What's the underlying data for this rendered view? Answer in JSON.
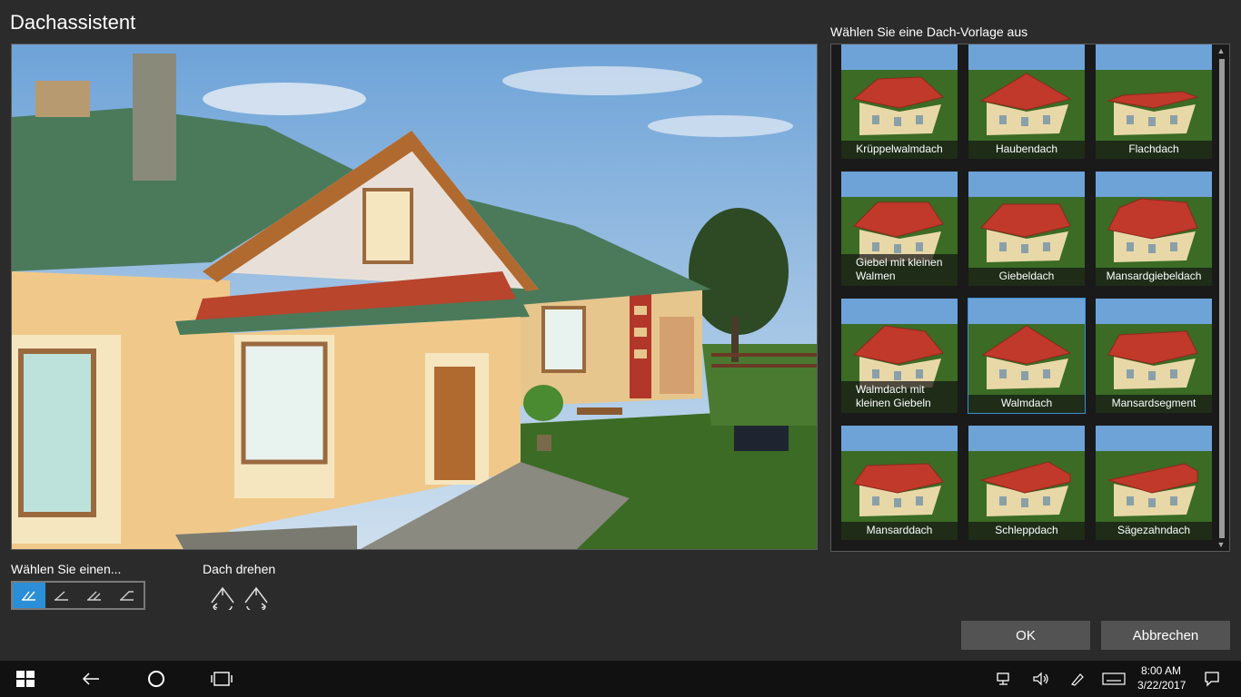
{
  "dialog": {
    "title": "Dachassistent"
  },
  "gallery": {
    "title": "Wählen Sie eine Dach-Vorlage aus",
    "templates": [
      {
        "label": "Krüppelwalmdach"
      },
      {
        "label": "Haubendach"
      },
      {
        "label": "Flachdach"
      },
      {
        "label": "Giebel mit kleinen Walmen"
      },
      {
        "label": "Giebeldach"
      },
      {
        "label": "Mansardgiebeldach"
      },
      {
        "label": "Walmdach mit kleinen Giebeln"
      },
      {
        "label": "Walmdach",
        "selected": true
      },
      {
        "label": "Mansardsegment"
      },
      {
        "label": "Mansarddach"
      },
      {
        "label": "Schleppdach"
      },
      {
        "label": "Sägezahndach"
      }
    ]
  },
  "select": {
    "label": "Wählen Sie einen..."
  },
  "rotate": {
    "label": "Dach drehen"
  },
  "buttons": {
    "ok": "OK",
    "cancel": "Abbrechen"
  },
  "taskbar": {
    "time": "8:00 AM",
    "date": "3/22/2017"
  },
  "colors": {
    "accent": "#2a8fd6",
    "roof": "#c0392b",
    "wall": "#e8d8a8",
    "grass": "#3b6b24"
  }
}
